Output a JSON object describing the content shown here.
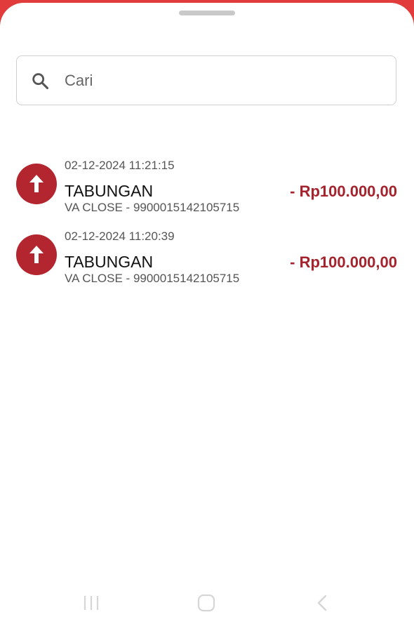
{
  "search": {
    "placeholder": "Cari",
    "icon": "search-icon"
  },
  "transactions": [
    {
      "date": "02-12-2024 11:21:15",
      "title": "TABUNGAN",
      "description": "VA CLOSE - 9900015142105715",
      "amount": "- Rp100.000,00",
      "direction_icon": "arrow-up-icon"
    },
    {
      "date": "02-12-2024 11:20:39",
      "title": "TABUNGAN",
      "description": "VA CLOSE - 9900015142105715",
      "amount": "- Rp100.000,00",
      "direction_icon": "arrow-up-icon"
    }
  ],
  "colors": {
    "brand_red": "#e23b3b",
    "accent_red": "#b3262f",
    "amount_red": "#a5232c"
  },
  "navigation": {
    "recent_icon": "recent-apps-icon",
    "home_icon": "home-icon",
    "back_icon": "back-icon"
  }
}
